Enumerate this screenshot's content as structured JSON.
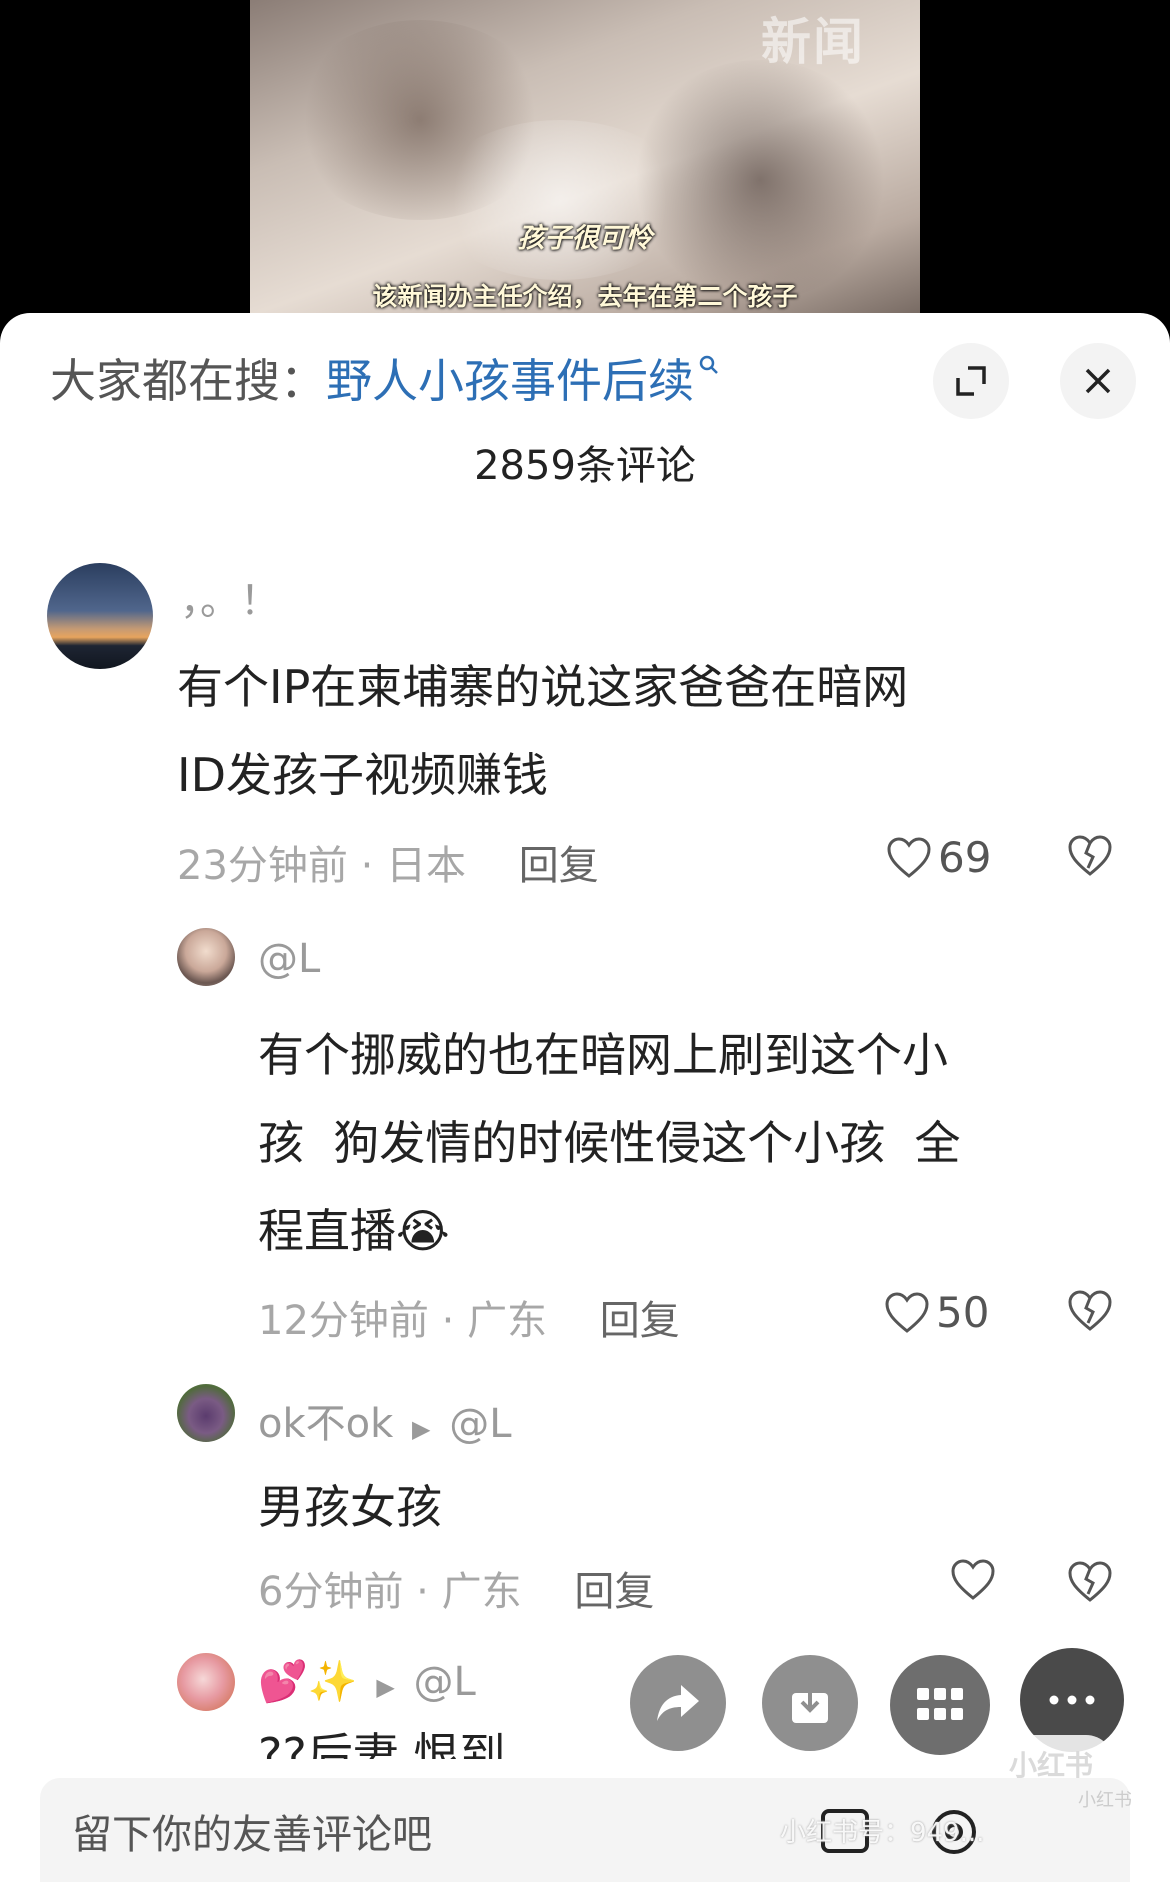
{
  "video": {
    "watermark": "新闻",
    "subtitle_1": "孩子很可怜",
    "subtitle_2": "该新闻办主任介绍，去年在第二个孩子"
  },
  "header": {
    "search_prefix": "大家都在搜：",
    "search_term": "野人小孩事件后续",
    "comment_count": "2859条评论"
  },
  "comments": [
    {
      "username": "，。！",
      "text_line1": "有个IP在柬埔寨的说这家爸爸在暗网",
      "text_line2": "ID发孩子视频赚钱",
      "time": "23分钟前",
      "location": "日本",
      "reply_label": "回复",
      "likes": "69"
    },
    {
      "username": "@L",
      "text_line1": "有个挪威的也在暗网上刷到这个小",
      "text_line2": "孩  狗发情的时候性侵这个小孩  全",
      "text_line3": "程直播",
      "emoji": "😭",
      "time": "12分钟前",
      "location": "广东",
      "reply_label": "回复",
      "likes": "50"
    },
    {
      "username": "ok不ok",
      "reply_to": "@L",
      "text_line1": "男孩女孩",
      "time": "6分钟前",
      "location": "广东",
      "reply_label": "回复",
      "likes": ""
    },
    {
      "username": "💕✨",
      "reply_to": "@L",
      "text_line1": "??后妻 恨到"
    }
  ],
  "input": {
    "placeholder": "留下你的友善评论吧"
  },
  "brand": {
    "logo_text": "小红书",
    "watermark_text": "小红书号：949...",
    "watermark_small": "小红书"
  },
  "colors": {
    "link_blue": "#2d6fb5",
    "background": "#ffffff"
  }
}
